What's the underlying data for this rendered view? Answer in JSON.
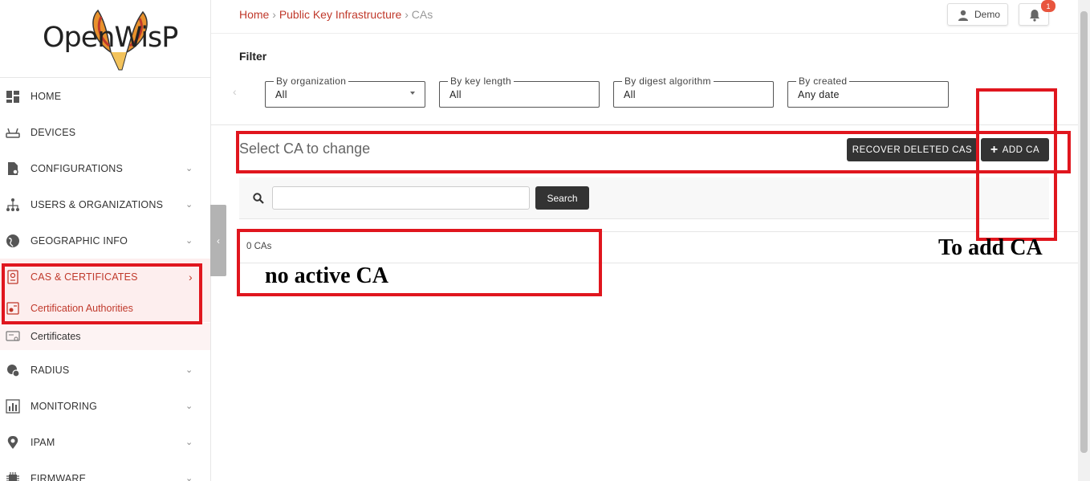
{
  "logo": {
    "text": "OpenWisP"
  },
  "sidebar": {
    "items": [
      {
        "label": "HOME",
        "icon": "dashboard-icon",
        "chevron": ""
      },
      {
        "label": "DEVICES",
        "icon": "router-icon",
        "chevron": ""
      },
      {
        "label": "CONFIGURATIONS",
        "icon": "config-file-icon",
        "chevron": "⌄"
      },
      {
        "label": "USERS & ORGANIZATIONS",
        "icon": "org-chart-icon",
        "chevron": "⌄"
      },
      {
        "label": "GEOGRAPHIC INFO",
        "icon": "globe-icon",
        "chevron": "⌄"
      },
      {
        "label": "CAS & CERTIFICATES",
        "icon": "certificate-icon",
        "chevron": "›"
      },
      {
        "label": "RADIUS",
        "icon": "radius-icon",
        "chevron": "⌄"
      },
      {
        "label": "MONITORING",
        "icon": "chart-icon",
        "chevron": "⌄"
      },
      {
        "label": "IPAM",
        "icon": "ip-pin-icon",
        "chevron": "⌄"
      },
      {
        "label": "FIRMWARE",
        "icon": "chip-icon",
        "chevron": "⌄"
      }
    ],
    "subitems": [
      {
        "label": "Certification Authorities",
        "icon": "ca-icon"
      },
      {
        "label": "Certificates",
        "icon": "certificate-doc-icon"
      }
    ]
  },
  "breadcrumb": {
    "home": "Home",
    "sep1": " › ",
    "section": "Public Key Infrastructure",
    "sep2": " › ",
    "current": "CAs"
  },
  "header": {
    "user": "Demo",
    "notifications": "1"
  },
  "filter": {
    "title": "Filter",
    "fields": [
      {
        "legend": "By organization",
        "value": "All"
      },
      {
        "legend": "By key length",
        "value": "All"
      },
      {
        "legend": "By digest algorithm",
        "value": "All"
      },
      {
        "legend": "By created",
        "value": "Any date"
      }
    ]
  },
  "main": {
    "heading": "Select CA to change",
    "recover_label": "RECOVER DELETED CAS",
    "add_label": "ADD CA",
    "search_value": "",
    "search_button": "Search",
    "result_count": "0 CAs"
  },
  "annotations": {
    "no_active": "no active CA",
    "to_add": "To add CA"
  },
  "colors": {
    "accent": "#c0392b",
    "annotation": "#e0161e",
    "dark_button": "#333333"
  }
}
